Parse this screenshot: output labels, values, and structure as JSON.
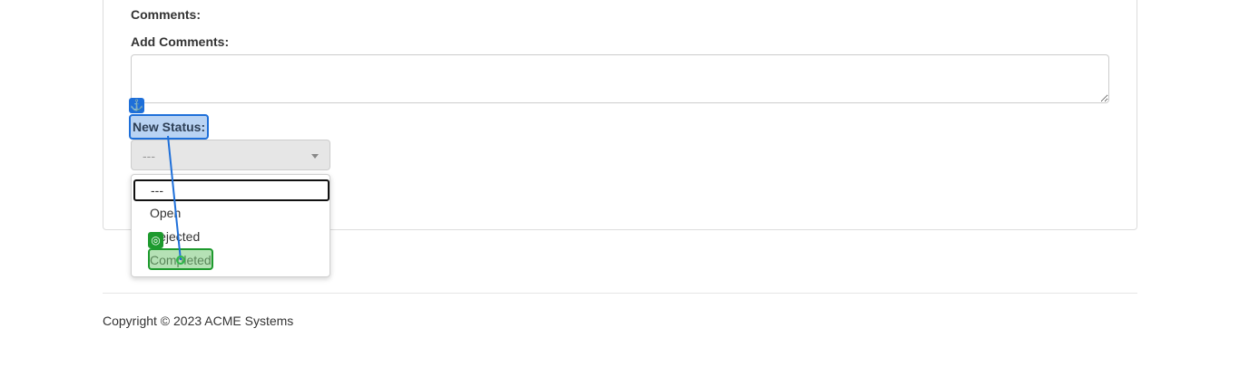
{
  "form": {
    "comments_label": "Comments:",
    "add_comments_label": "Add Comments:",
    "add_comments_value": "",
    "new_status_label": "New Status:",
    "status_select": {
      "selected": "---",
      "options": [
        "---",
        "Open",
        "Rejected",
        "Completed"
      ]
    }
  },
  "overlay": {
    "source_icon": "anchor-icon",
    "target_icon": "target-icon",
    "source_color": "#1e6fd9",
    "target_color": "#1e9a2e"
  },
  "footer": {
    "copyright": "Copyright © 2023 ACME Systems"
  }
}
